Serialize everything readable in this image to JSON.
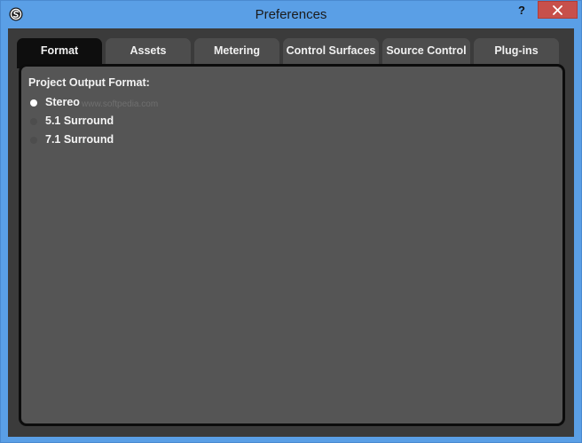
{
  "window": {
    "title": "Preferences",
    "help_label": "?"
  },
  "tabs": [
    {
      "label": "Format",
      "active": true
    },
    {
      "label": "Assets",
      "active": false
    },
    {
      "label": "Metering",
      "active": false
    },
    {
      "label": "Control Surfaces",
      "active": false
    },
    {
      "label": "Source Control",
      "active": false
    },
    {
      "label": "Plug-ins",
      "active": false
    }
  ],
  "format": {
    "section_label": "Project Output Format:",
    "options": [
      {
        "label": "Stereo",
        "selected": true
      },
      {
        "label": "5.1 Surround",
        "selected": false
      },
      {
        "label": "7.1 Surround",
        "selected": false
      }
    ]
  },
  "watermark": "www.softpedia.com",
  "colors": {
    "titlebar": "#5a9fe6",
    "close_button": "#c7504b",
    "client_background": "#3b3b3b",
    "panel_background": "#555555",
    "active_tab": "#0e0e0e",
    "inactive_tab": "#4d4d4d"
  }
}
